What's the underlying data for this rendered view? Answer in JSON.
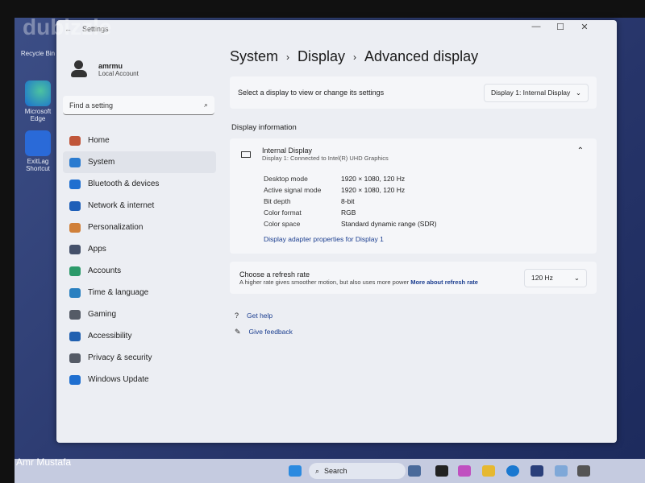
{
  "watermark": {
    "brand": "dubizzle",
    "author": "Amr Mustafa"
  },
  "desktop": {
    "icons": [
      {
        "label": "Recycle Bin"
      },
      {
        "label": "Microsoft Edge"
      },
      {
        "label": "ExitLag Shortcut"
      }
    ]
  },
  "window": {
    "title": "Settings",
    "controls": {
      "minimize": "—",
      "maximize": "☐",
      "close": "✕"
    }
  },
  "user": {
    "name": "amrmu",
    "account": "Local Account"
  },
  "search": {
    "placeholder": "Find a setting"
  },
  "sidebar": {
    "items": [
      {
        "label": "Home",
        "icon": "home-icon",
        "color": "#c0563a"
      },
      {
        "label": "System",
        "icon": "system-icon",
        "color": "#2a7bd0",
        "selected": true
      },
      {
        "label": "Bluetooth & devices",
        "icon": "bluetooth-icon",
        "color": "#1f6fd0"
      },
      {
        "label": "Network & internet",
        "icon": "wifi-icon",
        "color": "#1e5fb8"
      },
      {
        "label": "Personalization",
        "icon": "brush-icon",
        "color": "#d0803a"
      },
      {
        "label": "Apps",
        "icon": "apps-icon",
        "color": "#44506a"
      },
      {
        "label": "Accounts",
        "icon": "accounts-icon",
        "color": "#2c9a6a"
      },
      {
        "label": "Time & language",
        "icon": "globe-icon",
        "color": "#2a80c0"
      },
      {
        "label": "Gaming",
        "icon": "gamepad-icon",
        "color": "#555b66"
      },
      {
        "label": "Accessibility",
        "icon": "accessibility-icon",
        "color": "#2060b0"
      },
      {
        "label": "Privacy & security",
        "icon": "shield-icon",
        "color": "#555b66"
      },
      {
        "label": "Windows Update",
        "icon": "update-icon",
        "color": "#1f6fd0"
      }
    ]
  },
  "breadcrumb": [
    "System",
    "Display",
    "Advanced display"
  ],
  "select_display": {
    "label": "Select a display to view or change its settings",
    "value": "Display 1: Internal Display"
  },
  "display_info": {
    "heading": "Display information",
    "name": "Internal Display",
    "subtitle": "Display 1: Connected to Intel(R) UHD Graphics",
    "rows": [
      {
        "k": "Desktop mode",
        "v": "1920 × 1080, 120 Hz"
      },
      {
        "k": "Active signal mode",
        "v": "1920 × 1080, 120 Hz"
      },
      {
        "k": "Bit depth",
        "v": "8-bit"
      },
      {
        "k": "Color format",
        "v": "RGB"
      },
      {
        "k": "Color space",
        "v": "Standard dynamic range (SDR)"
      }
    ],
    "link": "Display adapter properties for Display 1"
  },
  "refresh": {
    "title": "Choose a refresh rate",
    "desc": "A higher rate gives smoother motion, but also uses more power",
    "link": "More about refresh rate",
    "value": "120 Hz"
  },
  "help": {
    "get_help": "Get help",
    "feedback": "Give feedback"
  },
  "taskbar": {
    "search": "Search"
  }
}
